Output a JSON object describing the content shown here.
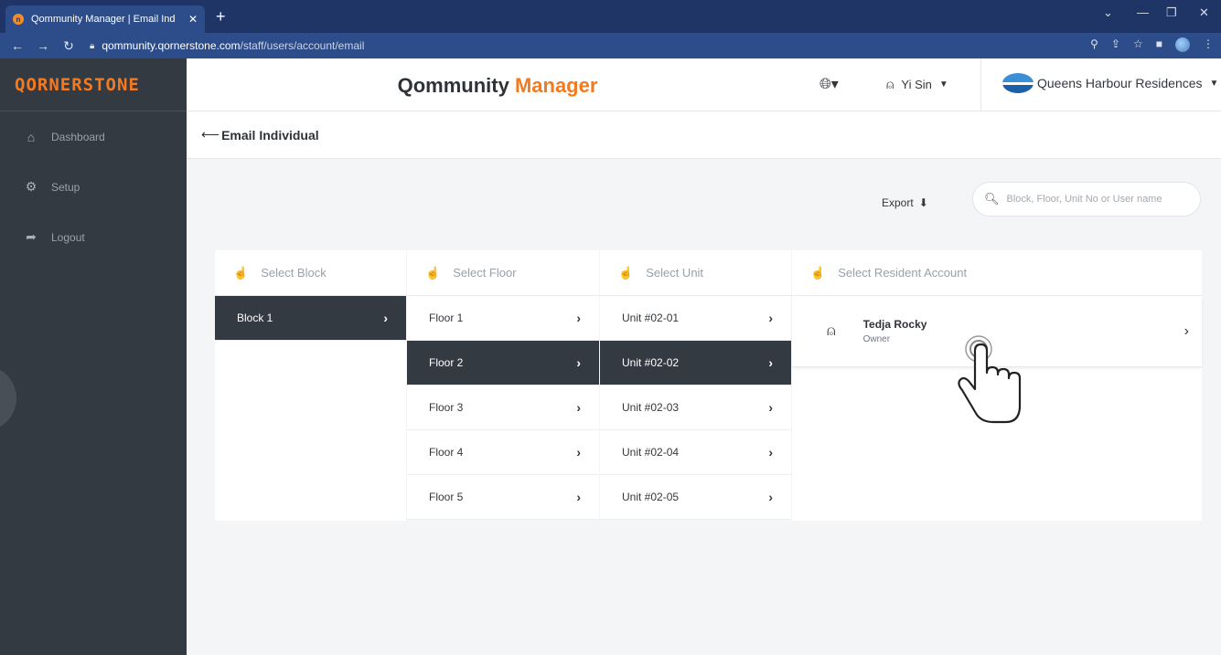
{
  "browser": {
    "tab_title": "Qommunity Manager | Email Ind",
    "tab_close": "✕",
    "new_tab": "+",
    "url_domain": "qommunity.qornerstone.com",
    "url_path": "/staff/users/account/email"
  },
  "sidebar": {
    "brand": "QORNERSTONE",
    "items": [
      {
        "label": "Dashboard",
        "icon": "home-icon"
      },
      {
        "label": "Setup",
        "icon": "gear-icon"
      },
      {
        "label": "Logout",
        "icon": "logout-icon"
      }
    ]
  },
  "header": {
    "title_main": "Qommunity",
    "title_accent": "Manager",
    "user_name": "Yi Sin",
    "estate_name": "Queens Harbour Residences"
  },
  "subheader": {
    "title": "Email Individual"
  },
  "toolbar": {
    "export_label": "Export",
    "search_placeholder": "Block, Floor, Unit No or User name"
  },
  "columns": {
    "block": {
      "header": "Select Block",
      "items": [
        {
          "label": "Block 1",
          "selected": true
        }
      ]
    },
    "floor": {
      "header": "Select Floor",
      "items": [
        {
          "label": "Floor 1",
          "selected": false
        },
        {
          "label": "Floor 2",
          "selected": true
        },
        {
          "label": "Floor 3",
          "selected": false
        },
        {
          "label": "Floor 4",
          "selected": false
        },
        {
          "label": "Floor 5",
          "selected": false
        }
      ]
    },
    "unit": {
      "header": "Select Unit",
      "items": [
        {
          "label": "Unit #02-01",
          "selected": false
        },
        {
          "label": "Unit #02-02",
          "selected": true
        },
        {
          "label": "Unit #02-03",
          "selected": false
        },
        {
          "label": "Unit #02-04",
          "selected": false
        },
        {
          "label": "Unit #02-05",
          "selected": false
        }
      ]
    },
    "resident": {
      "header": "Select Resident Account",
      "items": [
        {
          "name": "Tedja Rocky",
          "role": "Owner"
        }
      ]
    }
  },
  "colors": {
    "accent": "#f47a20",
    "sidebar_bg": "#343a42",
    "selected_row": "#343a42",
    "browser_chrome": "#1f3566"
  }
}
